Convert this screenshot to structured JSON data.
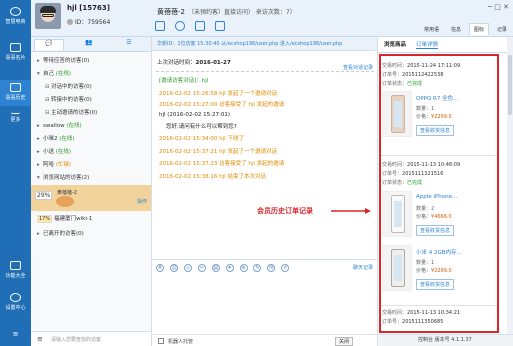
{
  "sidebar": {
    "items": [
      {
        "label": "智慧电商",
        "icon": "smart-commerce-icon"
      },
      {
        "label": "喜喜名片",
        "icon": "card-icon"
      },
      {
        "label": "喜喜历史",
        "icon": "history-icon"
      },
      {
        "label": "更多",
        "icon": "more-icon"
      },
      {
        "label": "功能大全",
        "icon": "apps-icon"
      },
      {
        "label": "设置中心",
        "icon": "settings-icon"
      }
    ]
  },
  "header": {
    "username": "hjl [15763]",
    "id_label": "ID：759564",
    "session_name": "黄蓓蓓-2",
    "session_info": "（未预约客）直接访问）  来访次数：7）",
    "right_tabs": [
      "常用语",
      "信息",
      "图标",
      "记录"
    ],
    "win_controls": "─  □  ✕"
  },
  "left_panel": {
    "tabs": [
      "对话",
      "访客",
      "排队"
    ],
    "rows": [
      {
        "text": "等待应答的访客(0)"
      },
      {
        "text": "自己 ",
        "status": "(在线)"
      },
      {
        "text": "对话中的访客(0)",
        "sub": true
      },
      {
        "text": "转接中的访客(0)",
        "sub": true
      },
      {
        "text": "主动邀请的访客(0)",
        "sub": true
      },
      {
        "text": "swallow ",
        "status": "(在线)"
      },
      {
        "text": "小咪2 ",
        "status": "(在线)"
      },
      {
        "text": "小送 ",
        "status": "(在线)"
      },
      {
        "text": "阿哈 ",
        "status": "(忙碌)",
        "busy": true
      },
      {
        "text": "浏览网站的访客(2)"
      }
    ],
    "visitor1": {
      "pct": "29%",
      "name": "黄蓓蓓-2",
      "op": "操作"
    },
    "visitor2": {
      "pct": "17%",
      "name": "福建厦门wiki-1"
    },
    "last_row": "已离开的访客(0)",
    "search_placeholder": "请输入您要查找的访客"
  },
  "chat": {
    "url": "华新ID：1位访客 15:30:40 从/ecshop198/user.php   进入/ecshop198/user.php",
    "last_visit_label": "上次对话时间：",
    "last_visit_date": "2016-01-27",
    "view_history": "查看对话记录",
    "messages": [
      {
        "text": "[邀请访客对话]：hjl",
        "style": "green"
      },
      {
        "text": "2016-02-02 15:26:58 hjl 发起了一个邀请对话",
        "style": "sys"
      },
      {
        "text": "2016-02-02 15:27:00 访客接受了 hjl 发起的邀请",
        "style": "sys"
      },
      {
        "text": "hjl (2016-02-02 15:27:01)",
        "style": "me"
      },
      {
        "text": "您好,请问有什么可以帮到您?",
        "style": "body"
      },
      {
        "text": "2016-02-02 15:34:00 hjl 下线了",
        "style": "sys"
      },
      {
        "text": "2016-02-02 15:37:21 hjl 发起了一个邀请对话",
        "style": "sys"
      },
      {
        "text": "2016-02-02 15:37:23 访客接受了 hjl 发起的邀请",
        "style": "sys"
      },
      {
        "text": "2016-02-02 15:38:16 hjl 结束了本次对话",
        "style": "sys"
      }
    ],
    "chat_record": "聊天记录",
    "robot_label": "机器人托管",
    "close_label": "关闭"
  },
  "right_panel": {
    "tab_a": "浏览商品",
    "tab_b": "订单详情",
    "orders": [
      {
        "time_label": "交易时间：",
        "time": "2015-11-24 17:11:09",
        "no_label": "订单号：",
        "no": "2015112422538",
        "status_label": "订单状态：",
        "status": "已完成"
      },
      {
        "time_label": "交易时间：",
        "time": "2015-11-13 10:48:09",
        "no_label": "订单号：",
        "no": "2015111321516",
        "status_label": "订单状态：",
        "status": "已完成"
      },
      {
        "time_label": "交易时间：",
        "time": "2015-11-13 10:34:21",
        "no_label": "订单号：",
        "no": "2015111350685",
        "status_label": "",
        "status": ""
      }
    ],
    "products": [
      {
        "name": "OPPO R7 全色...",
        "qty": "数量：1",
        "price_label": "价格：",
        "price": "¥2299.0",
        "btn": "查看收货信息"
      },
      {
        "name": "Apple iPhone...",
        "qty": "数量：2",
        "price_label": "价格：",
        "price": "¥4666.0",
        "btn": "查看收货信息"
      },
      {
        "name": "小米 4 2GB内存...",
        "qty": "数量：1",
        "price_label": "价格：",
        "price": "¥2299.0",
        "btn": "查看收货信息"
      }
    ]
  },
  "annotation": "会员历史订单记录",
  "status_bar": "控制台  版本号 4.1.1.37",
  "colors": {
    "sidebar": "#1f6eb6",
    "accent": "#2d83d1",
    "highlight": "#d7262c"
  }
}
